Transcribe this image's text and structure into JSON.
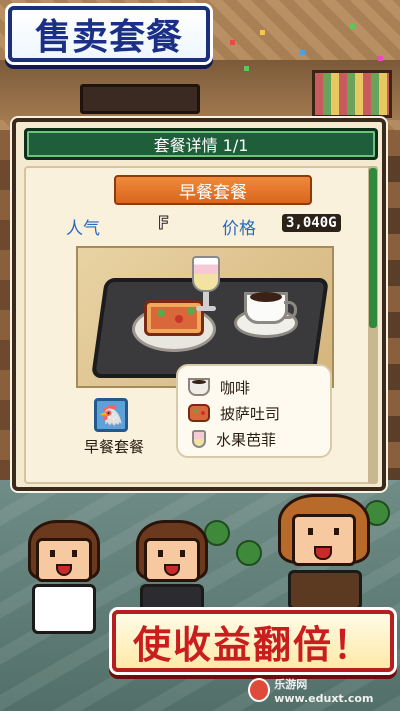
{
  "banner_top": "售卖套餐",
  "banner_bottom": "使收益翻倍！",
  "dialog": {
    "header": "套餐详情 1/1",
    "meal_name": "早餐套餐",
    "popularity_label": "人气",
    "popularity_grade": "F",
    "price_label": "价格",
    "price_value": "3,040G",
    "meal_caption": "早餐套餐",
    "items": [
      {
        "icon": "coffee-icon",
        "label": "咖啡"
      },
      {
        "icon": "pizza-toast-icon",
        "label": "披萨吐司"
      },
      {
        "icon": "parfait-icon",
        "label": "水果芭菲"
      }
    ]
  },
  "watermark": "乐游网 www.eduxt.com",
  "colors": {
    "banner_top_text": "#1c2f86",
    "banner_bottom_text": "#c81e1e",
    "dialog_header_bg": "#1f5e3a",
    "meal_name_bg": "#e07a2a",
    "stat_label": "#2b6bbf"
  }
}
